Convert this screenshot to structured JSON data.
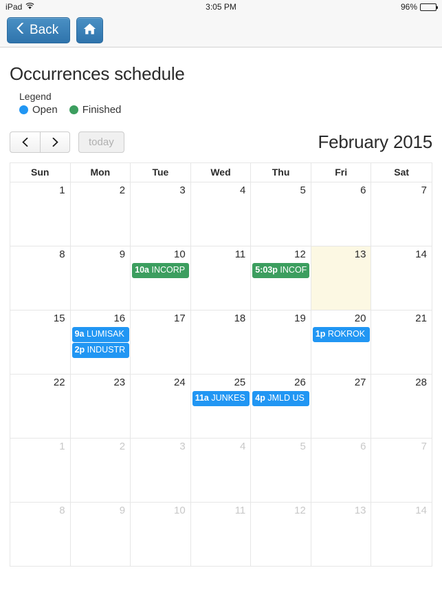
{
  "status_bar": {
    "device": "iPad",
    "wifi_icon": "wifi-icon",
    "time": "3:05 PM",
    "battery_percent": "96%",
    "battery_level": 96
  },
  "toolbar": {
    "back_label": "Back",
    "back_icon": "chevron-left-icon",
    "home_icon": "home-icon"
  },
  "page": {
    "title": "Occurrences schedule"
  },
  "legend": {
    "title": "Legend",
    "items": [
      {
        "label": "Open",
        "color": "#2196f3"
      },
      {
        "label": "Finished",
        "color": "#3c9e5f"
      }
    ]
  },
  "calendar_toolbar": {
    "prev_label": "‹",
    "prev_icon": "chevron-left-icon",
    "next_label": "›",
    "next_icon": "chevron-right-icon",
    "today_label": "today",
    "today_disabled": true,
    "month_title": "February 2015"
  },
  "calendar": {
    "day_headers": [
      "Sun",
      "Mon",
      "Tue",
      "Wed",
      "Thu",
      "Fri",
      "Sat"
    ],
    "weeks": [
      [
        {
          "day": "1",
          "other_month": false,
          "today": false,
          "events": []
        },
        {
          "day": "2",
          "other_month": false,
          "today": false,
          "events": []
        },
        {
          "day": "3",
          "other_month": false,
          "today": false,
          "events": []
        },
        {
          "day": "4",
          "other_month": false,
          "today": false,
          "events": []
        },
        {
          "day": "5",
          "other_month": false,
          "today": false,
          "events": []
        },
        {
          "day": "6",
          "other_month": false,
          "today": false,
          "events": []
        },
        {
          "day": "7",
          "other_month": false,
          "today": false,
          "events": []
        }
      ],
      [
        {
          "day": "8",
          "other_month": false,
          "today": false,
          "events": []
        },
        {
          "day": "9",
          "other_month": false,
          "today": false,
          "events": []
        },
        {
          "day": "10",
          "other_month": false,
          "today": false,
          "events": [
            {
              "time": "10a",
              "title": "INCORP",
              "status": "finished"
            }
          ]
        },
        {
          "day": "11",
          "other_month": false,
          "today": false,
          "events": []
        },
        {
          "day": "12",
          "other_month": false,
          "today": false,
          "events": [
            {
              "time": "5:03p",
              "title": "INCOF",
              "status": "finished"
            }
          ]
        },
        {
          "day": "13",
          "other_month": false,
          "today": true,
          "events": []
        },
        {
          "day": "14",
          "other_month": false,
          "today": false,
          "events": []
        }
      ],
      [
        {
          "day": "15",
          "other_month": false,
          "today": false,
          "events": []
        },
        {
          "day": "16",
          "other_month": false,
          "today": false,
          "events": [
            {
              "time": "9a",
              "title": "LUMISAK",
              "status": "open"
            },
            {
              "time": "2p",
              "title": "INDUSTR",
              "status": "open"
            }
          ]
        },
        {
          "day": "17",
          "other_month": false,
          "today": false,
          "events": []
        },
        {
          "day": "18",
          "other_month": false,
          "today": false,
          "events": []
        },
        {
          "day": "19",
          "other_month": false,
          "today": false,
          "events": []
        },
        {
          "day": "20",
          "other_month": false,
          "today": false,
          "events": [
            {
              "time": "1p",
              "title": "ROKROK",
              "status": "open"
            }
          ]
        },
        {
          "day": "21",
          "other_month": false,
          "today": false,
          "events": []
        }
      ],
      [
        {
          "day": "22",
          "other_month": false,
          "today": false,
          "events": []
        },
        {
          "day": "23",
          "other_month": false,
          "today": false,
          "events": []
        },
        {
          "day": "24",
          "other_month": false,
          "today": false,
          "events": []
        },
        {
          "day": "25",
          "other_month": false,
          "today": false,
          "events": [
            {
              "time": "11a",
              "title": "JUNKES",
              "status": "open"
            }
          ]
        },
        {
          "day": "26",
          "other_month": false,
          "today": false,
          "events": [
            {
              "time": "4p",
              "title": "JMLD US",
              "status": "open"
            }
          ]
        },
        {
          "day": "27",
          "other_month": false,
          "today": false,
          "events": []
        },
        {
          "day": "28",
          "other_month": false,
          "today": false,
          "events": []
        }
      ],
      [
        {
          "day": "1",
          "other_month": true,
          "today": false,
          "events": []
        },
        {
          "day": "2",
          "other_month": true,
          "today": false,
          "events": []
        },
        {
          "day": "3",
          "other_month": true,
          "today": false,
          "events": []
        },
        {
          "day": "4",
          "other_month": true,
          "today": false,
          "events": []
        },
        {
          "day": "5",
          "other_month": true,
          "today": false,
          "events": []
        },
        {
          "day": "6",
          "other_month": true,
          "today": false,
          "events": []
        },
        {
          "day": "7",
          "other_month": true,
          "today": false,
          "events": []
        }
      ],
      [
        {
          "day": "8",
          "other_month": true,
          "today": false,
          "events": []
        },
        {
          "day": "9",
          "other_month": true,
          "today": false,
          "events": []
        },
        {
          "day": "10",
          "other_month": true,
          "today": false,
          "events": []
        },
        {
          "day": "11",
          "other_month": true,
          "today": false,
          "events": []
        },
        {
          "day": "12",
          "other_month": true,
          "today": false,
          "events": []
        },
        {
          "day": "13",
          "other_month": true,
          "today": false,
          "events": []
        },
        {
          "day": "14",
          "other_month": true,
          "today": false,
          "events": []
        }
      ]
    ]
  }
}
